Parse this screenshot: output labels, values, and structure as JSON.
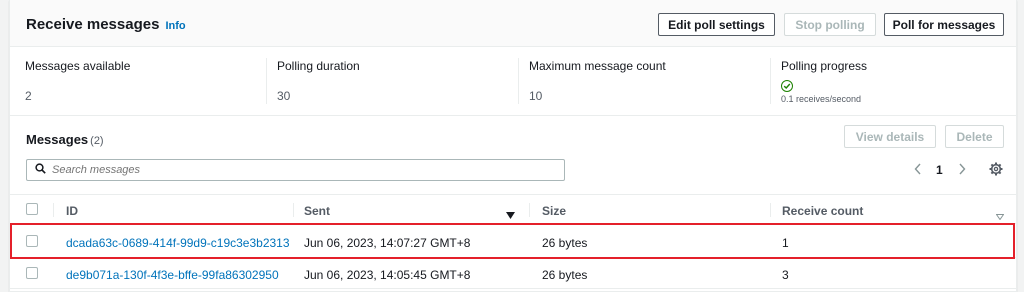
{
  "receive": {
    "title": "Receive messages",
    "info": "Info",
    "buttons": {
      "edit": "Edit poll settings",
      "stop": "Stop polling",
      "poll": "Poll for messages"
    },
    "stats": [
      {
        "label": "Messages available",
        "value": "2"
      },
      {
        "label": "Polling duration",
        "value": "30"
      },
      {
        "label": "Maximum message count",
        "value": "10"
      },
      {
        "label": "Polling progress",
        "value": "0.1 receives/second"
      }
    ]
  },
  "messages": {
    "title": "Messages",
    "count": "(2)",
    "buttons": {
      "view": "View details",
      "delete": "Delete"
    },
    "search_placeholder": "Search messages",
    "page": "1",
    "columns": {
      "id": "ID",
      "sent": "Sent",
      "size": "Size",
      "receive_count": "Receive count"
    },
    "rows": [
      {
        "id": "dcada63c-0689-414f-99d9-c19c3e3b2313",
        "sent": "Jun 06, 2023, 14:07:27 GMT+8",
        "size": "26 bytes",
        "receive_count": "1"
      },
      {
        "id": "de9b071a-130f-4f3e-bffe-99fa86302950",
        "sent": "Jun 06, 2023, 14:05:45 GMT+8",
        "size": "26 bytes",
        "receive_count": "3"
      }
    ]
  },
  "colors": {
    "link": "#0073bb",
    "success": "#1d8102",
    "highlight": "#e4202a"
  }
}
